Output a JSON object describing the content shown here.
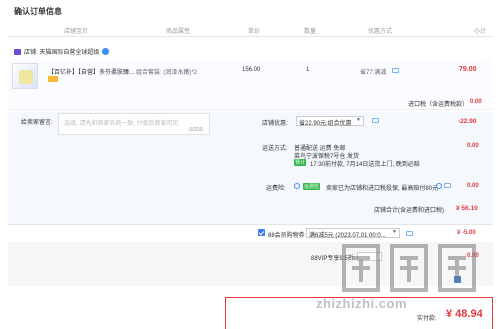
{
  "page": {
    "title": "确认订单信息"
  },
  "table_headers": [
    "店铺宝贝",
    "商品属性",
    "单价",
    "数量",
    "优惠方式",
    "小计"
  ],
  "store": {
    "name": "店铺: 天猫国际自营全球超级"
  },
  "item": {
    "name": "【百亿补】【自营】多芬柔肤臻...",
    "attr": "组合套装: (润泽水嫩)*2",
    "price": "156.00",
    "qty": "1",
    "promo": "省77:满减",
    "subtotal": "79.00"
  },
  "tax": {
    "label": "进口税（含运费税款）",
    "value": "0.00"
  },
  "message": {
    "label": "给卖家留言:",
    "placeholder": "选填, 请先和商家协商一致, 付款后商家可见",
    "count": "0/200"
  },
  "coupon": {
    "label": "店铺优惠:",
    "selected": "省22.90元:组合优惠",
    "value": "-22.90"
  },
  "shipping": {
    "label": "运送方式:",
    "line1": "普通配送 运费 免邮",
    "line2": "菜鸟宁波保税7号仓  发货",
    "tag": "预计",
    "line3": "17:30前付款, 7月14日送货上门, 晚到必赔",
    "value": "0.00"
  },
  "insurance": {
    "label": "运费险:",
    "tag": "运费险",
    "text": "卖家已为店铺和进口税投保, 最高赔付80元",
    "value": "0.00"
  },
  "store_total": {
    "label": "店铺合计(含运费和进口税)",
    "value": "¥ 56.10"
  },
  "redpacket": {
    "label": "88会员购物券",
    "selected": "满6减5元 (2023.07.01 00:0...",
    "value": "¥ -5.00"
  },
  "vip": {
    "label": "88VIP专享9.5折",
    "value": "0.00"
  },
  "final": {
    "label": "实付款:",
    "value": "¥ 48.94"
  },
  "watermark": {
    "text": "zhizhizhi.com"
  },
  "colors": {
    "accent": "#e4393c",
    "brand_blue": "#3d7cf0",
    "green": "#2eb84a"
  }
}
